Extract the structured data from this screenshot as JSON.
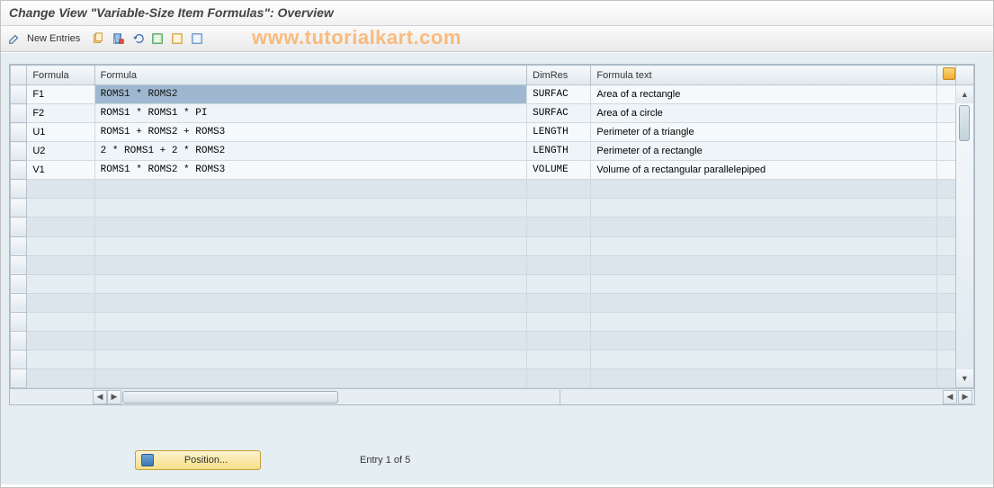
{
  "title": "Change View \"Variable-Size Item Formulas\": Overview",
  "watermark": "www.tutorialkart.com",
  "toolbar": {
    "new_entries_label": "New Entries"
  },
  "columns": {
    "formula_key": "Formula",
    "formula": "Formula",
    "dimres": "DimRes",
    "formula_text": "Formula text"
  },
  "rows": [
    {
      "key": "F1",
      "formula": "ROMS1 * ROMS2",
      "dimres": "SURFAC",
      "text": "Area of a rectangle",
      "selected": true
    },
    {
      "key": "F2",
      "formula": "ROMS1 * ROMS1 * PI",
      "dimres": "SURFAC",
      "text": "Area of a circle"
    },
    {
      "key": "U1",
      "formula": "ROMS1 + ROMS2 + ROMS3",
      "dimres": "LENGTH",
      "text": "Perimeter of a triangle"
    },
    {
      "key": "U2",
      "formula": "2 * ROMS1 + 2 * ROMS2",
      "dimres": "LENGTH",
      "text": "Perimeter of a rectangle"
    },
    {
      "key": "V1",
      "formula": "ROMS1 * ROMS2 * ROMS3",
      "dimres": "VOLUME",
      "text": "Volume of a rectangular parallelepiped"
    }
  ],
  "empty_row_count": 11,
  "footer": {
    "position_label": "Position...",
    "entry_text": "Entry 1 of 5"
  }
}
